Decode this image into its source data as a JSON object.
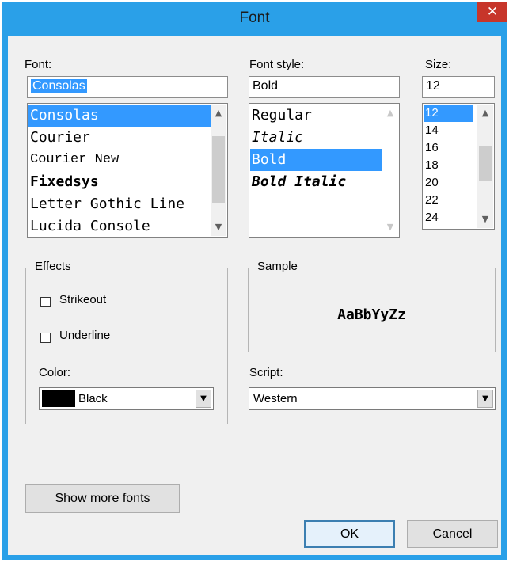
{
  "dialog": {
    "title": "Font",
    "close_glyph": "✕"
  },
  "font": {
    "label": "Font:",
    "value": "Consolas",
    "items": [
      "Consolas",
      "Courier",
      "Courier New",
      "Fixedsys",
      "Letter Gothic Line",
      "Lucida Console"
    ],
    "selected": "Consolas"
  },
  "style": {
    "label": "Font style:",
    "value": "Bold",
    "items": [
      "Regular",
      "Italic",
      "Bold",
      "Bold Italic"
    ],
    "selected": "Bold"
  },
  "size": {
    "label": "Size:",
    "value": "12",
    "items": [
      "12",
      "14",
      "16",
      "18",
      "20",
      "22",
      "24"
    ],
    "selected": "12"
  },
  "effects": {
    "title": "Effects",
    "strikeout_label": "Strikeout",
    "strikeout_checked": false,
    "underline_label": "Underline",
    "underline_checked": false,
    "color_label": "Color:",
    "color_value": "Black",
    "color_hex": "#000000"
  },
  "sample": {
    "title": "Sample",
    "text": "AaBbYyZz"
  },
  "script": {
    "label": "Script:",
    "value": "Western"
  },
  "buttons": {
    "show_more": "Show more fonts",
    "ok": "OK",
    "cancel": "Cancel"
  },
  "icons": {
    "scroll_up": "chevron-up-icon",
    "scroll_down": "chevron-down-icon",
    "dropdown": "triangle-down-icon"
  },
  "colors": {
    "accent": "#3399ff",
    "title_bar": "#2aa0e8",
    "close": "#c7352a"
  }
}
